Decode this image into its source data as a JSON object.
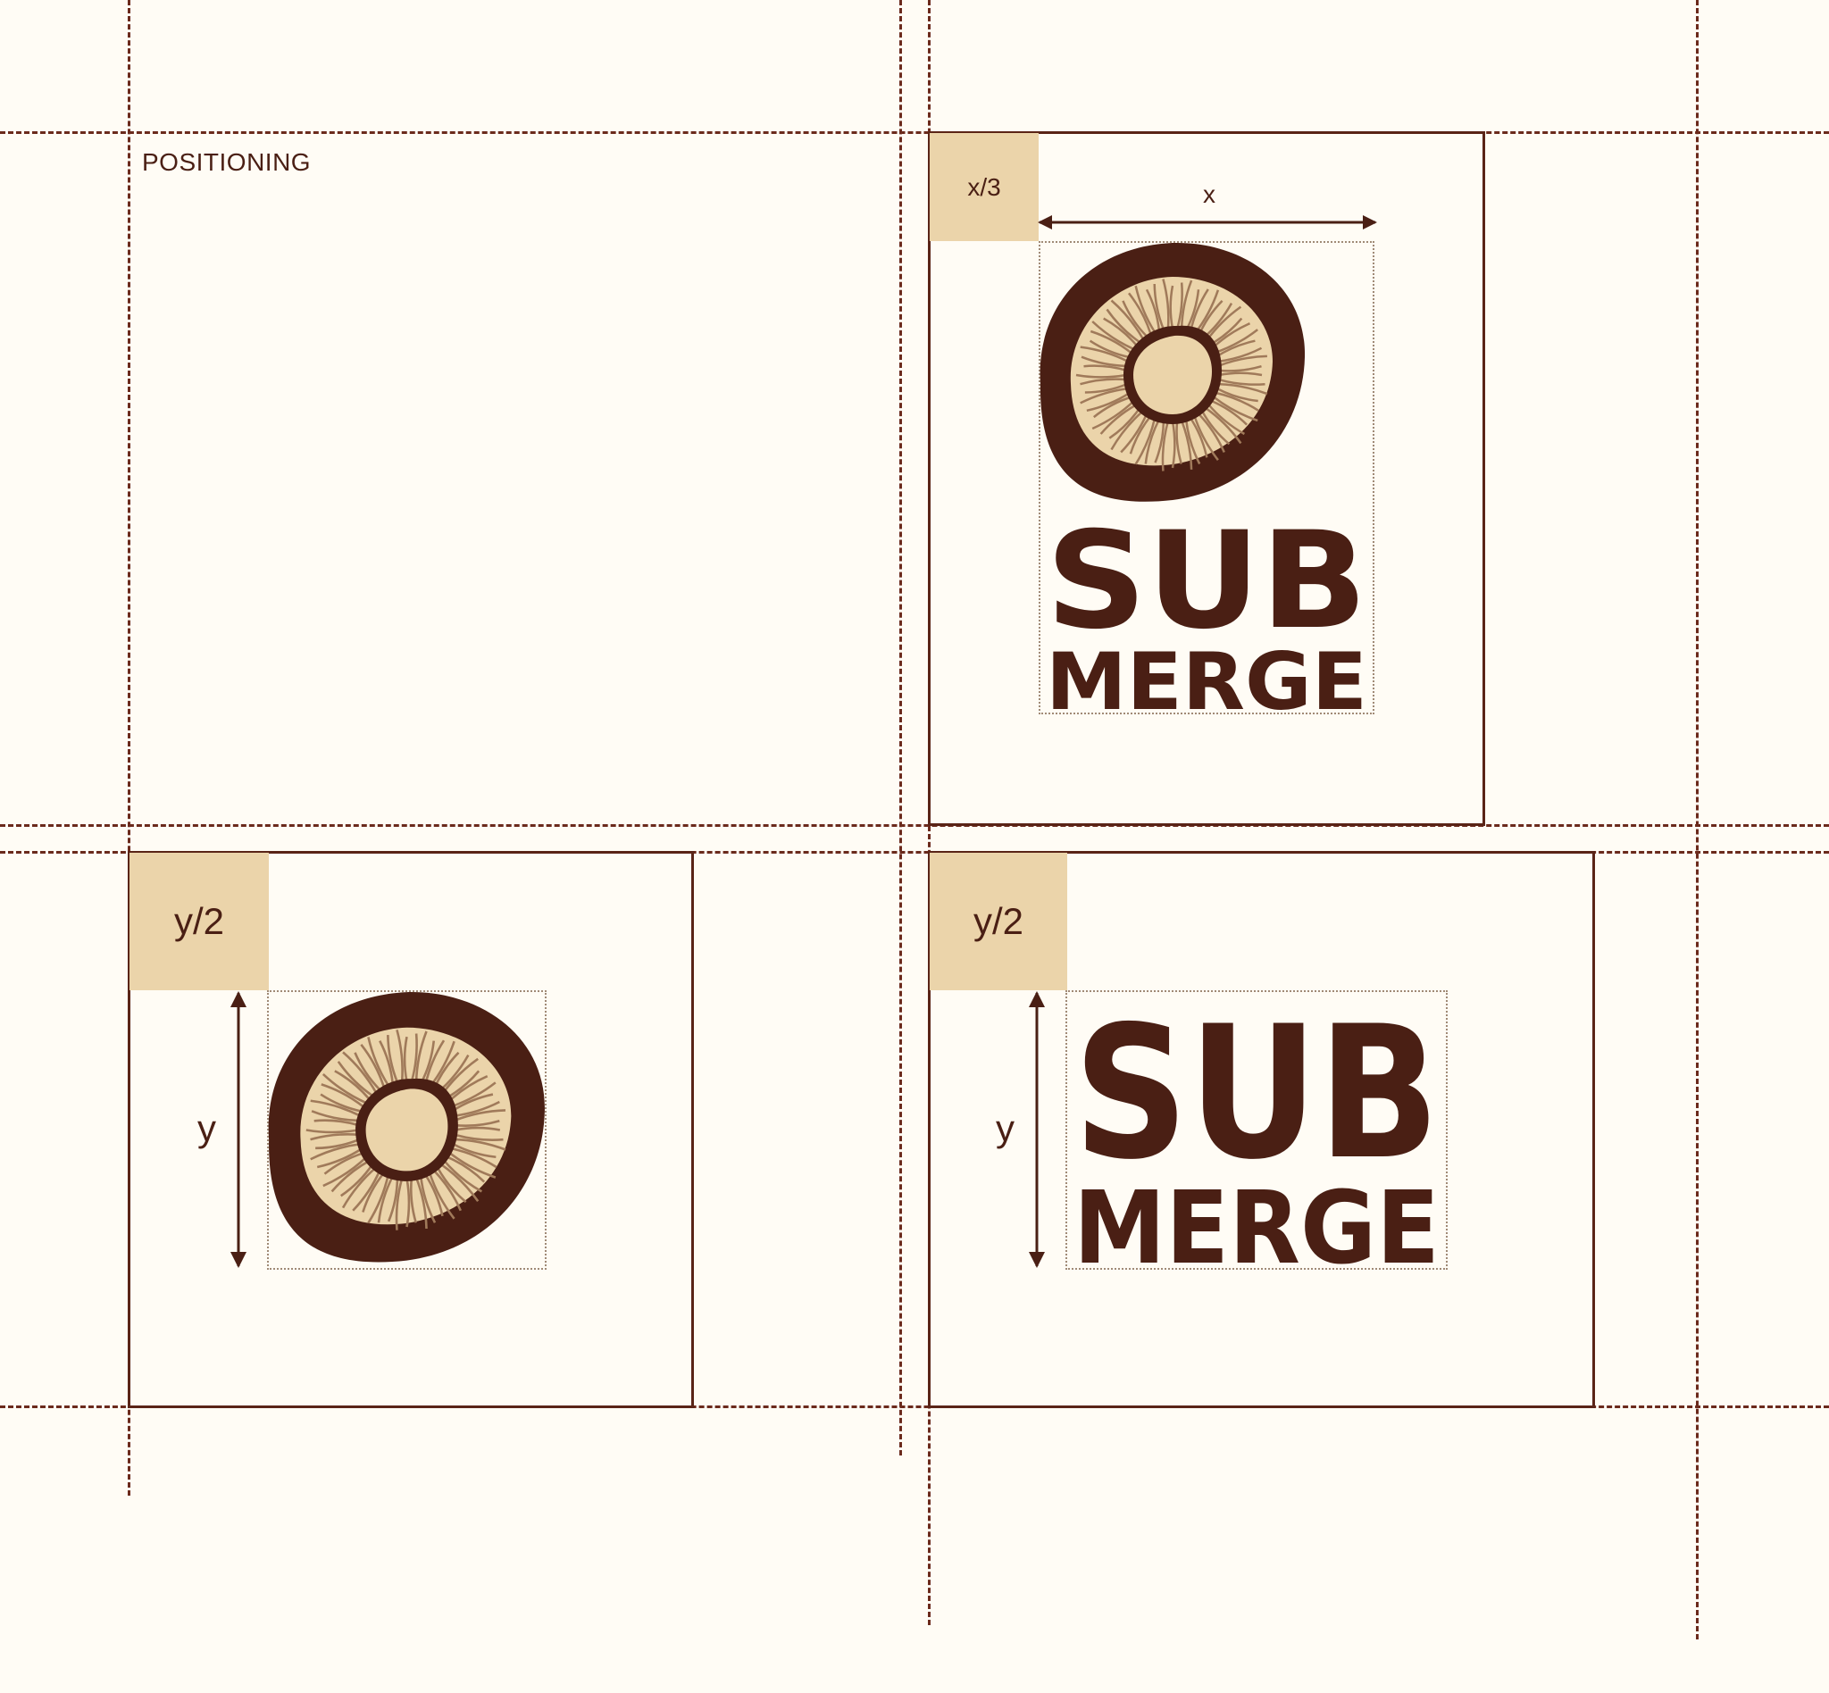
{
  "section": {
    "title": "POSITIONING"
  },
  "panels": {
    "full_logo": {
      "margin_label": "x/3",
      "dimension_label": "x"
    },
    "symbol": {
      "margin_label": "y/2",
      "dimension_label": "y"
    },
    "wordmark": {
      "margin_label": "y/2",
      "dimension_label": "y"
    }
  },
  "logo": {
    "word_top": "SUB",
    "word_bottom": "MERGE"
  },
  "colors": {
    "background": "#fffcf5",
    "dark_brown": "#4a1f14",
    "tan": "#ebd4aa",
    "gill_line": "#a07a5a"
  }
}
